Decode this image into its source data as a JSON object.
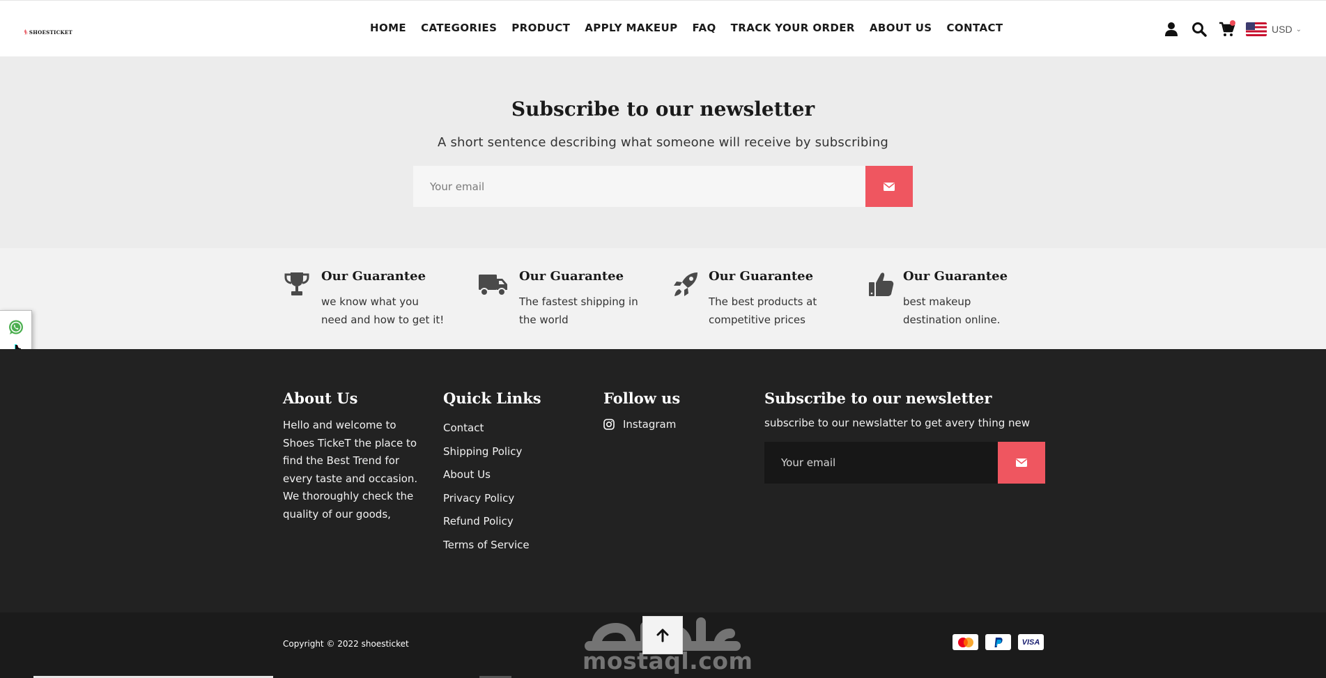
{
  "header": {
    "logo_text": "SHOESTICKET",
    "nav": [
      "HOME",
      "CATEGORIES",
      "PRODUCT",
      "APPLY MAKEUP",
      "FAQ",
      "TRACK YOUR ORDER",
      "ABOUT US",
      "CONTACT"
    ],
    "icons": [
      "user-icon",
      "search-icon",
      "cart-icon"
    ],
    "currency": "USD"
  },
  "newsletter": {
    "title": "Subscribe to our newsletter",
    "subtitle": "A short sentence describing what someone will receive by subscribing",
    "email_placeholder": "Your email"
  },
  "guarantees": [
    {
      "icon": "trophy-icon",
      "title": "Our Guarantee",
      "text": "we know what you need and how to get it!"
    },
    {
      "icon": "truck-icon",
      "title": "Our Guarantee",
      "text": "The fastest shipping in the world"
    },
    {
      "icon": "rocket-icon",
      "title": "Our Guarantee",
      "text": "The best products at competitive prices"
    },
    {
      "icon": "thumbs-up-icon",
      "title": "Our Guarantee",
      "text": "best makeup destination online."
    }
  ],
  "side_social": [
    "whatsapp-icon",
    "tiktok-icon"
  ],
  "footer": {
    "about": {
      "title": "About Us",
      "text": "Hello and welcome to Shoes TickeT the place to find the Best Trend for every taste and occasion. We thoroughly check the quality of our goods,"
    },
    "quick_links": {
      "title": "Quick Links",
      "items": [
        "Contact",
        "Shipping Policy",
        "About Us",
        "Privacy Policy",
        "Refund Policy",
        "Terms of Service"
      ]
    },
    "follow": {
      "title": "Follow us",
      "instagram": "Instagram"
    },
    "newsletter": {
      "title": "Subscribe to our newsletter",
      "text": "subscribe to our newslatter to get avery thing new",
      "email_placeholder": "Your email"
    }
  },
  "bottom": {
    "copyright": "Copyright © 2022 shoesticket",
    "payments": [
      "mastercard-icon",
      "paypal-icon",
      "visa-icon"
    ],
    "visa_label": "VISA",
    "watermark": "mostaql.com"
  },
  "colors": {
    "accent": "#ef5660",
    "footer_bg": "#222222",
    "newsletter_bg": "#ececec"
  }
}
